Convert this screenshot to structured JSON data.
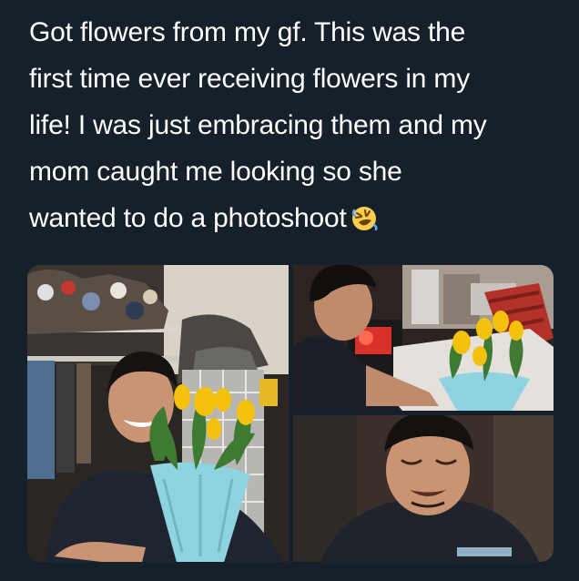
{
  "tweet": {
    "lines": [
      "Got flowers from my gf. This was the",
      "first time ever receiving flowers in my",
      "life! I was just embracing them and my",
      "mom caught me looking so she",
      "wanted to do a photoshoot"
    ],
    "emoji_icon": "rolling-on-floor-laughing-emoji"
  },
  "media": {
    "photos": [
      {
        "name": "photo-holding-tulips"
      },
      {
        "name": "photo-looking-at-tulips"
      },
      {
        "name": "photo-smiling-down"
      }
    ]
  },
  "colors": {
    "background": "#15202b",
    "text": "#ffffff",
    "tulip_yellow": "#f4c20d",
    "wrap_blue": "#8fd3e0"
  }
}
